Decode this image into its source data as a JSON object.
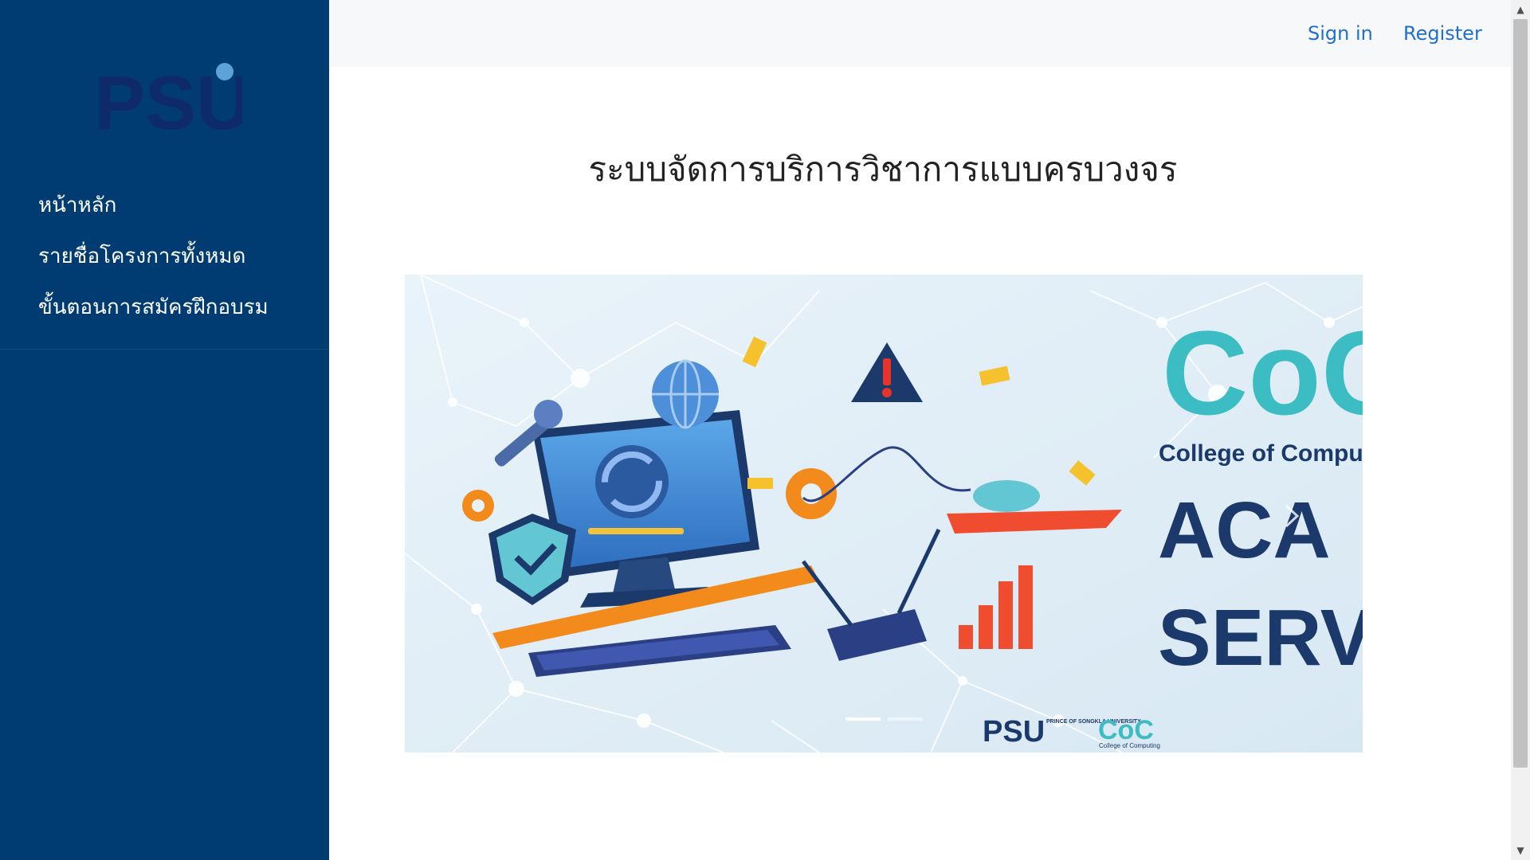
{
  "sidebar": {
    "logo": "PSU",
    "items": [
      {
        "label": "หน้าหลัก"
      },
      {
        "label": "รายชื่อโครงการทั้งหมด"
      },
      {
        "label": "ขั้นตอนการสมัครฝึกอบรม"
      }
    ]
  },
  "header": {
    "signin_label": "Sign in",
    "register_label": "Register"
  },
  "main": {
    "title": "ระบบจัดการบริการวิชาการแบบครบวงจร",
    "banner": {
      "org_logo": "CoC",
      "org_text": "College of Compu",
      "headline_1": "ACA",
      "headline_2": "SERV",
      "footer_logo_1": "PSU",
      "footer_logo_1_text": "PRINCE OF SONGKLA UNIVERSITY",
      "footer_logo_2": "CoC",
      "footer_logo_2_text": "College of Computing",
      "active_slide": 1,
      "slide_count": 2
    }
  },
  "colors": {
    "sidebar": "#003c71",
    "link": "#1f6fd1",
    "teal": "#3cbcc3",
    "navy": "#1b3a6b",
    "orange": "#f28a1c"
  },
  "icons": [
    "chevron-right-icon",
    "scroll-up-icon",
    "scroll-down-icon"
  ]
}
